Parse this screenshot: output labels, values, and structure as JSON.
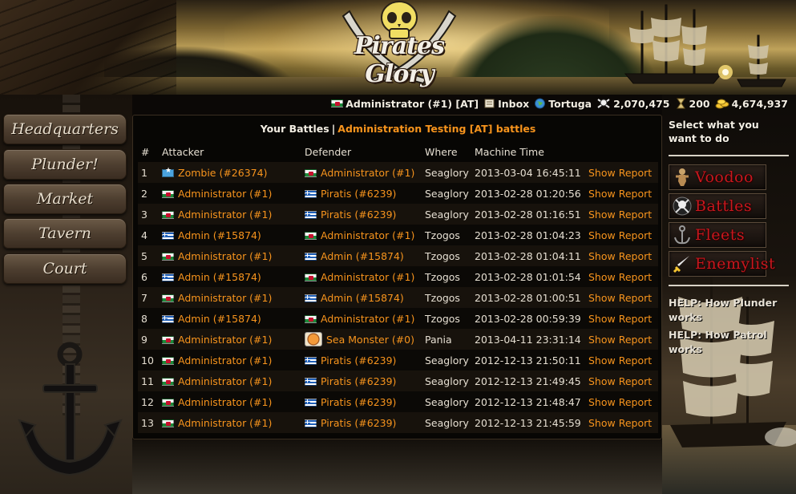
{
  "logo": {
    "text": "Pirates Glory"
  },
  "status": {
    "user": "Administrator (#1) [AT]",
    "inbox": "Inbox",
    "location": "Tortuga",
    "pirates": "2,070,475",
    "time_units": "200",
    "gold": "4,674,937"
  },
  "nav": {
    "items": [
      {
        "label": "Headquarters"
      },
      {
        "label": "Plunder!"
      },
      {
        "label": "Market"
      },
      {
        "label": "Tavern"
      },
      {
        "label": "Court"
      }
    ]
  },
  "main": {
    "tab_current": "Your Battles",
    "separator": "|",
    "tab_other": "Administration Testing [AT] battles",
    "columns": [
      "#",
      "Attacker",
      "Defender",
      "Where",
      "Machine Time"
    ],
    "report_label": "Show Report",
    "rows": [
      {
        "n": "1",
        "attacker": "Zombie (#26374)",
        "attacker_flag": "somalia",
        "defender": "Administrator (#1)",
        "defender_flag": "wales",
        "where": "Seaglory",
        "time": "2013-03-04 16:45:11"
      },
      {
        "n": "2",
        "attacker": "Administrator (#1)",
        "attacker_flag": "wales",
        "defender": "Piratis (#6239)",
        "defender_flag": "greece",
        "where": "Seaglory",
        "time": "2013-02-28 01:20:56"
      },
      {
        "n": "3",
        "attacker": "Administrator (#1)",
        "attacker_flag": "wales",
        "defender": "Piratis (#6239)",
        "defender_flag": "greece",
        "where": "Seaglory",
        "time": "2013-02-28 01:16:51"
      },
      {
        "n": "4",
        "attacker": "Admin (#15874)",
        "attacker_flag": "greece",
        "defender": "Administrator (#1)",
        "defender_flag": "wales",
        "where": "Tzogos",
        "time": "2013-02-28 01:04:23"
      },
      {
        "n": "5",
        "attacker": "Administrator (#1)",
        "attacker_flag": "wales",
        "defender": "Admin (#15874)",
        "defender_flag": "greece",
        "where": "Tzogos",
        "time": "2013-02-28 01:04:11"
      },
      {
        "n": "6",
        "attacker": "Admin (#15874)",
        "attacker_flag": "greece",
        "defender": "Administrator (#1)",
        "defender_flag": "wales",
        "where": "Tzogos",
        "time": "2013-02-28 01:01:54"
      },
      {
        "n": "7",
        "attacker": "Administrator (#1)",
        "attacker_flag": "wales",
        "defender": "Admin (#15874)",
        "defender_flag": "greece",
        "where": "Tzogos",
        "time": "2013-02-28 01:00:51"
      },
      {
        "n": "8",
        "attacker": "Admin (#15874)",
        "attacker_flag": "greece",
        "defender": "Administrator (#1)",
        "defender_flag": "wales",
        "where": "Tzogos",
        "time": "2013-02-28 00:59:39"
      },
      {
        "n": "9",
        "attacker": "Administrator (#1)",
        "attacker_flag": "wales",
        "defender": "Sea Monster (#0)",
        "defender_flag": "monster",
        "where": "Pania",
        "time": "2013-04-11 23:31:14"
      },
      {
        "n": "10",
        "attacker": "Administrator (#1)",
        "attacker_flag": "wales",
        "defender": "Piratis (#6239)",
        "defender_flag": "greece",
        "where": "Seaglory",
        "time": "2012-12-13 21:50:11"
      },
      {
        "n": "11",
        "attacker": "Administrator (#1)",
        "attacker_flag": "wales",
        "defender": "Piratis (#6239)",
        "defender_flag": "greece",
        "where": "Seaglory",
        "time": "2012-12-13 21:49:45"
      },
      {
        "n": "12",
        "attacker": "Administrator (#1)",
        "attacker_flag": "wales",
        "defender": "Piratis (#6239)",
        "defender_flag": "greece",
        "where": "Seaglory",
        "time": "2012-12-13 21:48:47"
      },
      {
        "n": "13",
        "attacker": "Administrator (#1)",
        "attacker_flag": "wales",
        "defender": "Piratis (#6239)",
        "defender_flag": "greece",
        "where": "Seaglory",
        "time": "2012-12-13 21:45:59"
      }
    ]
  },
  "sidebar": {
    "heading": "Select what you want to do",
    "buttons": [
      {
        "label": "Voodoo",
        "icon": "voodoo-doll-icon"
      },
      {
        "label": "Battles",
        "icon": "skull-crossbones-icon"
      },
      {
        "label": "Fleets",
        "icon": "anchor-icon"
      },
      {
        "label": "Enemylist",
        "icon": "sword-icon"
      }
    ],
    "help": [
      {
        "label": "HELP: How Plunder works"
      },
      {
        "label": "HELP: How Patrol works"
      }
    ]
  },
  "colors": {
    "accent": "#f7941d",
    "sidebar_button_text": "#c8181e",
    "panel_bg": "#080604"
  }
}
